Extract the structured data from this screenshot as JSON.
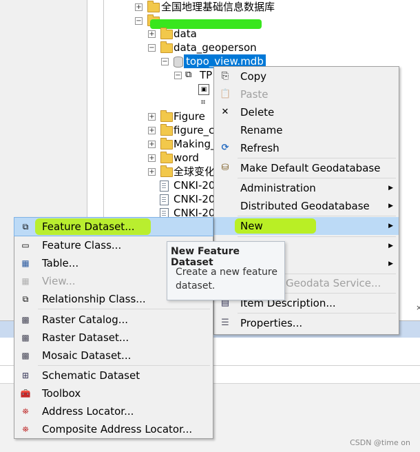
{
  "tree": {
    "items": [
      {
        "label": "全国地理基础信息数据库",
        "kind": "folder",
        "expander": "+"
      },
      {
        "label": "",
        "kind": "folder",
        "expander": "-"
      },
      {
        "label": "data",
        "kind": "folder",
        "expander": "+"
      },
      {
        "label": "data_geoperson",
        "kind": "folder",
        "expander": "-"
      },
      {
        "label": "topo_view.mdb",
        "kind": "database",
        "expander": "-"
      },
      {
        "label": "TP",
        "kind": "dataset",
        "expander": "-"
      },
      {
        "label": "Figure",
        "kind": "folder",
        "expander": "+"
      },
      {
        "label": "figure_c",
        "kind": "folder",
        "expander": "+"
      },
      {
        "label": "Making_",
        "kind": "folder",
        "expander": "+"
      },
      {
        "label": "word",
        "kind": "folder",
        "expander": "+"
      },
      {
        "label": "全球变化",
        "kind": "folder",
        "expander": "+"
      },
      {
        "label": "CNKI-20",
        "kind": "file"
      },
      {
        "label": "CNKI-20",
        "kind": "file"
      },
      {
        "label": "CNKI-20",
        "kind": "file"
      }
    ]
  },
  "context_menu": {
    "items": [
      {
        "label": "Copy",
        "icon": "copy-icon",
        "glyph": "⎘",
        "enabled": true
      },
      {
        "label": "Paste",
        "icon": "paste-icon",
        "glyph": "📋",
        "enabled": false
      },
      {
        "label": "Delete",
        "icon": "delete-icon",
        "glyph": "✕",
        "enabled": true
      },
      {
        "label": "Rename",
        "icon": "",
        "glyph": "",
        "enabled": true
      },
      {
        "label": "Refresh",
        "icon": "refresh-icon",
        "glyph": "⟳",
        "enabled": true
      },
      {
        "label": "Make Default Geodatabase",
        "icon": "geodatabase-icon",
        "glyph": "⛁",
        "enabled": true
      },
      {
        "label": "Administration",
        "icon": "",
        "glyph": "",
        "enabled": true,
        "submenu": true
      },
      {
        "label": "Distributed Geodatabase",
        "icon": "",
        "glyph": "",
        "enabled": true,
        "submenu": true
      },
      {
        "label": "New",
        "icon": "",
        "glyph": "",
        "enabled": true,
        "submenu": true,
        "selected": true
      },
      {
        "label": "",
        "icon": "",
        "glyph": "",
        "enabled": true,
        "submenu": true
      },
      {
        "label": "",
        "icon": "",
        "glyph": "",
        "enabled": true,
        "submenu": true
      },
      {
        "label": "Geodata Service...",
        "icon": "",
        "glyph": "",
        "enabled": false
      },
      {
        "label": "Item Description...",
        "icon": "item-description-icon",
        "glyph": "▤",
        "enabled": true
      },
      {
        "label": "Properties...",
        "icon": "properties-icon",
        "glyph": "☰",
        "enabled": true
      }
    ]
  },
  "new_submenu": {
    "items": [
      {
        "label": "Feature Dataset...",
        "icon": "feature-dataset-icon",
        "glyph": "⧉",
        "enabled": true,
        "selected": true
      },
      {
        "label": "Feature Class...",
        "icon": "feature-class-icon",
        "glyph": "▭",
        "enabled": true
      },
      {
        "label": "Table...",
        "icon": "table-icon",
        "glyph": "▦",
        "enabled": true
      },
      {
        "label": "View...",
        "icon": "view-icon",
        "glyph": "▦",
        "enabled": false
      },
      {
        "label": "Relationship Class...",
        "icon": "relationship-class-icon",
        "glyph": "⧉",
        "enabled": true
      },
      {
        "label": "Raster Catalog...",
        "icon": "raster-catalog-icon",
        "glyph": "▩",
        "enabled": true
      },
      {
        "label": "Raster Dataset...",
        "icon": "raster-dataset-icon",
        "glyph": "▩",
        "enabled": true
      },
      {
        "label": "Mosaic Dataset...",
        "icon": "mosaic-dataset-icon",
        "glyph": "▩",
        "enabled": true
      },
      {
        "label": "Schematic Dataset",
        "icon": "schematic-dataset-icon",
        "glyph": "⊞",
        "enabled": true
      },
      {
        "label": "Toolbox",
        "icon": "toolbox-icon",
        "glyph": "🧰",
        "enabled": true
      },
      {
        "label": "Address Locator...",
        "icon": "address-locator-icon",
        "glyph": "⛯",
        "enabled": true
      },
      {
        "label": "Composite Address Locator...",
        "icon": "composite-address-locator-icon",
        "glyph": "⛯",
        "enabled": true
      }
    ]
  },
  "tooltip": {
    "title": "New Feature Dataset",
    "body": "Create a new feature dataset."
  },
  "watermark": "CSDN @time on",
  "colors": {
    "selection": "#0078d7",
    "menu_hover": "#bcdaf6",
    "annotation_green": "#b8f019",
    "redaction_green": "#39e61e"
  }
}
